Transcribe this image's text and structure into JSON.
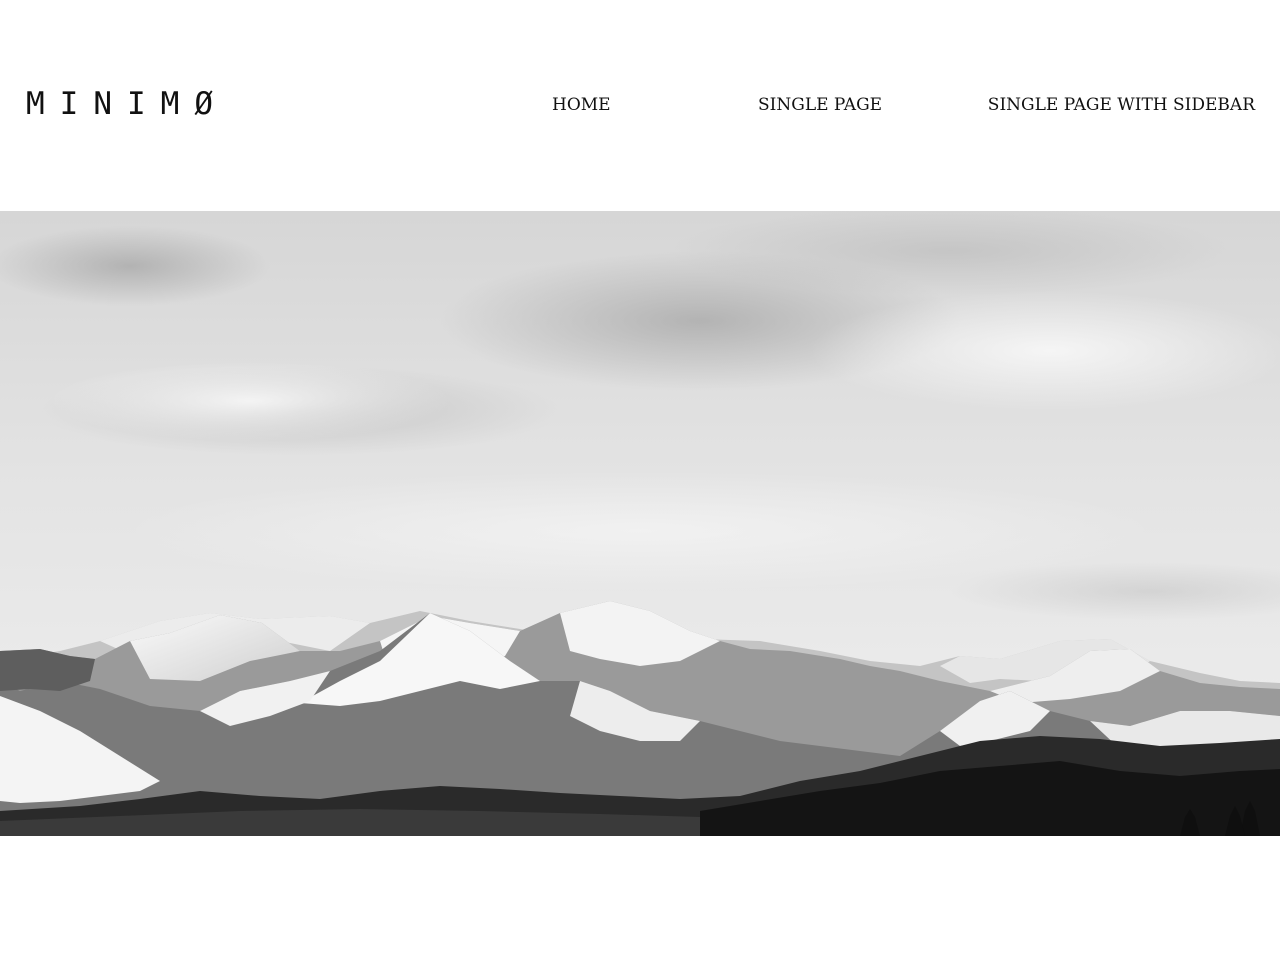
{
  "site": {
    "logo": "MINIMØ"
  },
  "nav": {
    "items": [
      {
        "label": "HOME"
      },
      {
        "label": "SINGLE PAGE"
      },
      {
        "label": "SINGLE PAGE WITH SIDEBAR"
      }
    ]
  },
  "hero": {
    "image_icon": "mountain-landscape-icon",
    "subject": "mountain range",
    "colors": {
      "sky_top": "#d8d8d8",
      "sky_bottom": "#efefef",
      "snow": "#f4f4f4",
      "rock": "#6e6e6e",
      "forest": "#1a1a1a"
    }
  }
}
